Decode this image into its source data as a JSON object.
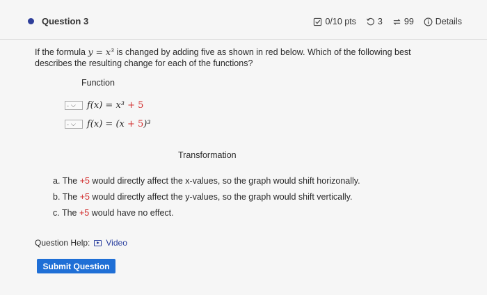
{
  "header": {
    "question_title": "Question 3",
    "points": "0/10 pts",
    "attempts": "3",
    "submissions": "99",
    "details": "Details"
  },
  "question": {
    "text_prefix": "If the formula ",
    "formula": "y = x³",
    "text_suffix": " is changed by adding five as shown in red below. Which of the following best describes the resulting change for each of the functions?",
    "function_label": "Function",
    "functions": [
      {
        "select": "-",
        "expr_left": "f(x) = x³ ",
        "expr_red": "+ 5",
        "expr_right": ""
      },
      {
        "select": "-",
        "expr_left": "f(x) = (x ",
        "expr_red": "+ 5",
        "expr_right": ")³"
      }
    ],
    "transformation_label": "Transformation",
    "options": [
      {
        "prefix": "a. The ",
        "red": "+5",
        "suffix": " would directly affect the x-values, so the graph would shift horizonally."
      },
      {
        "prefix": "b. The ",
        "red": "+5",
        "suffix": " would directly affect the y-values, so the graph would shift vertically."
      },
      {
        "prefix": "c. The ",
        "red": "+5",
        "suffix": " would have no effect."
      }
    ]
  },
  "help": {
    "label": "Question Help:",
    "video": "Video"
  },
  "submit_label": "Submit Question",
  "colors": {
    "accent": "#1f6fd6",
    "red": "#d12a2a",
    "bullet": "#2e3f9a"
  }
}
